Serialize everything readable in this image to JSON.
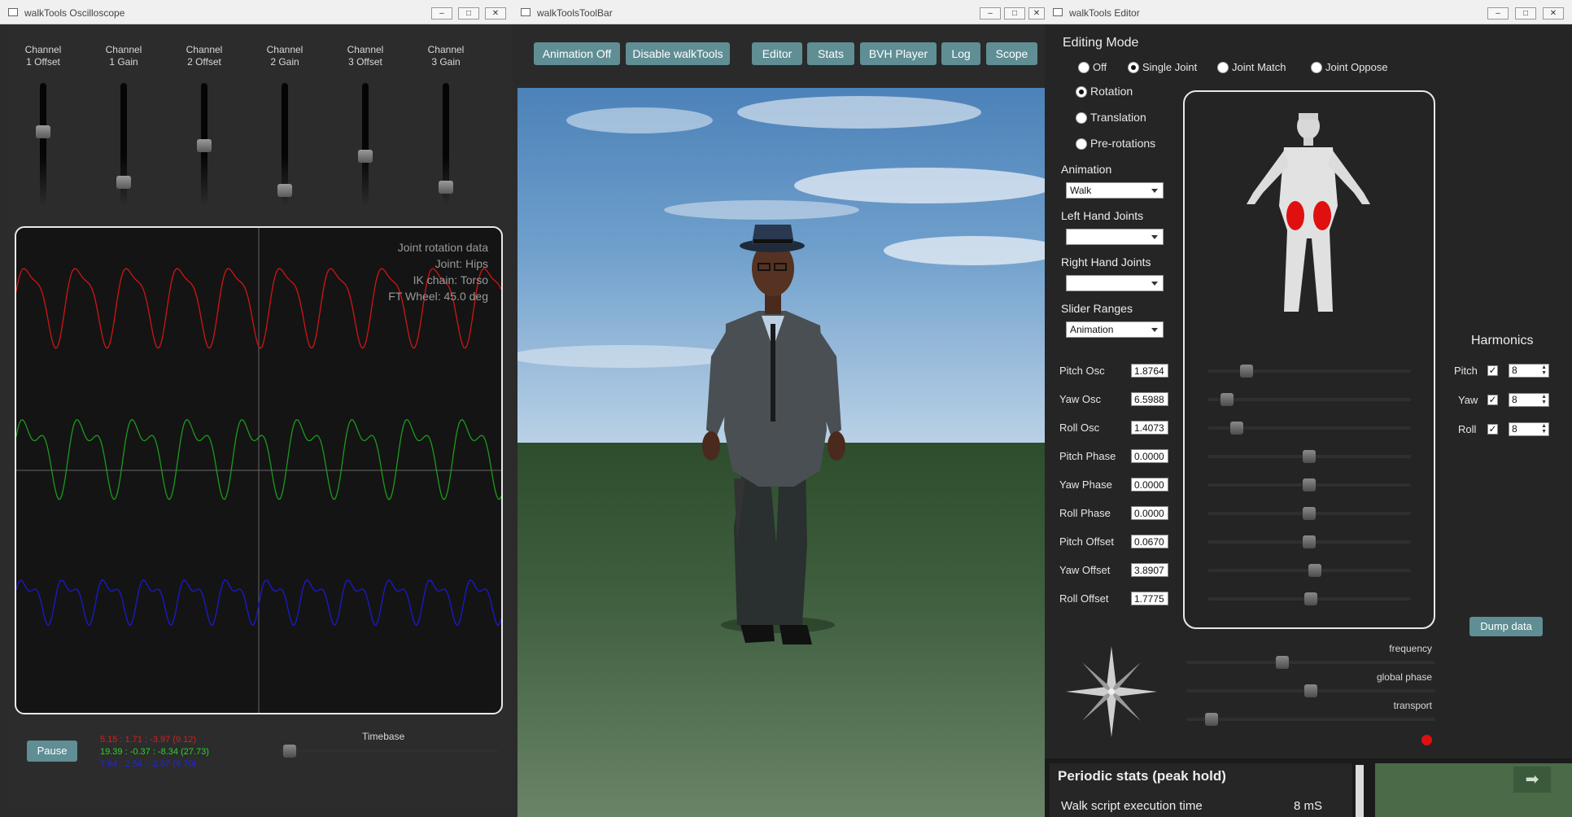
{
  "oscilloscope": {
    "title": "walkTools Oscilloscope",
    "channels": [
      {
        "label_line1": "Channel",
        "label_line2": "1 Offset",
        "level": 0.6
      },
      {
        "label_line1": "Channel",
        "label_line2": "1 Gain",
        "level": 0.12
      },
      {
        "label_line1": "Channel",
        "label_line2": "2 Offset",
        "level": 0.47
      },
      {
        "label_line1": "Channel",
        "label_line2": "2 Gain",
        "level": 0.05
      },
      {
        "label_line1": "Channel",
        "label_line2": "3 Offset",
        "level": 0.37
      },
      {
        "label_line1": "Channel",
        "label_line2": "3 Gain",
        "level": 0.08
      }
    ],
    "info": {
      "line1": "Joint rotation data",
      "line2": "Joint: Hips",
      "line3": "IK chain: Torso",
      "line4": "FT Wheel: 45.0 deg"
    },
    "pause_label": "Pause",
    "readouts": [
      {
        "text": "5.15 : 1.71 : -3.97 (9.12)",
        "color": "#e11b1b"
      },
      {
        "text": "19.39 : -0.37 : -8.34 (27.73)",
        "color": "#2ad32a"
      },
      {
        "text": "7.64 : 2.54 : -2.07 (9.70)",
        "color": "#2222ee"
      }
    ],
    "timebase_label": "Timebase",
    "timebase_level": 0.02,
    "trace_colors": [
      "#d11414",
      "#1c9a1c",
      "#1a1ad0"
    ]
  },
  "toolbar": {
    "title": "walkToolsToolBar",
    "buttons": [
      "Animation Off",
      "Disable walkTools",
      "Editor",
      "Stats",
      "BVH Player",
      "Log",
      "Scope"
    ]
  },
  "editor": {
    "title": "walkTools Editor",
    "editing_mode_label": "Editing Mode",
    "modes": [
      {
        "label": "Off",
        "selected": false
      },
      {
        "label": "Single Joint",
        "selected": true
      },
      {
        "label": "Joint Match",
        "selected": false
      },
      {
        "label": "Joint Oppose",
        "selected": false
      }
    ],
    "sub_modes": [
      {
        "label": "Rotation",
        "selected": true
      },
      {
        "label": "Translation",
        "selected": false
      },
      {
        "label": "Pre-rotations",
        "selected": false
      }
    ],
    "animation_label": "Animation",
    "animation_value": "Walk",
    "left_hand_label": "Left Hand Joints",
    "left_hand_value": "",
    "right_hand_label": "Right Hand Joints",
    "right_hand_value": "",
    "slider_ranges_label": "Slider Ranges",
    "slider_ranges_value": "Animation",
    "params": [
      {
        "label": "Pitch Osc",
        "value": "1.8764",
        "level": 0.17
      },
      {
        "label": "Yaw Osc",
        "value": "6.5988",
        "level": 0.07
      },
      {
        "label": "Roll Osc",
        "value": "1.4073",
        "level": 0.12
      },
      {
        "label": "Pitch Phase",
        "value": "0.0000",
        "level": 0.5
      },
      {
        "label": "Yaw Phase",
        "value": "0.0000",
        "level": 0.5
      },
      {
        "label": "Roll Phase",
        "value": "0.0000",
        "level": 0.5
      },
      {
        "label": "Pitch Offset",
        "value": "0.0670",
        "level": 0.5
      },
      {
        "label": "Yaw Offset",
        "value": "3.8907",
        "level": 0.53
      },
      {
        "label": "Roll Offset",
        "value": "1.7775",
        "level": 0.51
      }
    ],
    "harmonics_label": "Harmonics",
    "harmonics": [
      {
        "label": "Pitch",
        "checked": true,
        "value": "8"
      },
      {
        "label": "Yaw",
        "checked": true,
        "value": "8"
      },
      {
        "label": "Roll",
        "checked": true,
        "value": "8"
      }
    ],
    "dump_label": "Dump data",
    "bottom_sliders": [
      {
        "label": "frequency",
        "level": 0.38
      },
      {
        "label": "global phase",
        "level": 0.5
      },
      {
        "label": "transport",
        "level": 0.08
      }
    ],
    "highlight_color": "#e01010"
  },
  "stats": {
    "title": "Periodic stats (peak hold)",
    "row_label": "Walk script execution time",
    "row_value": "8 mS"
  }
}
